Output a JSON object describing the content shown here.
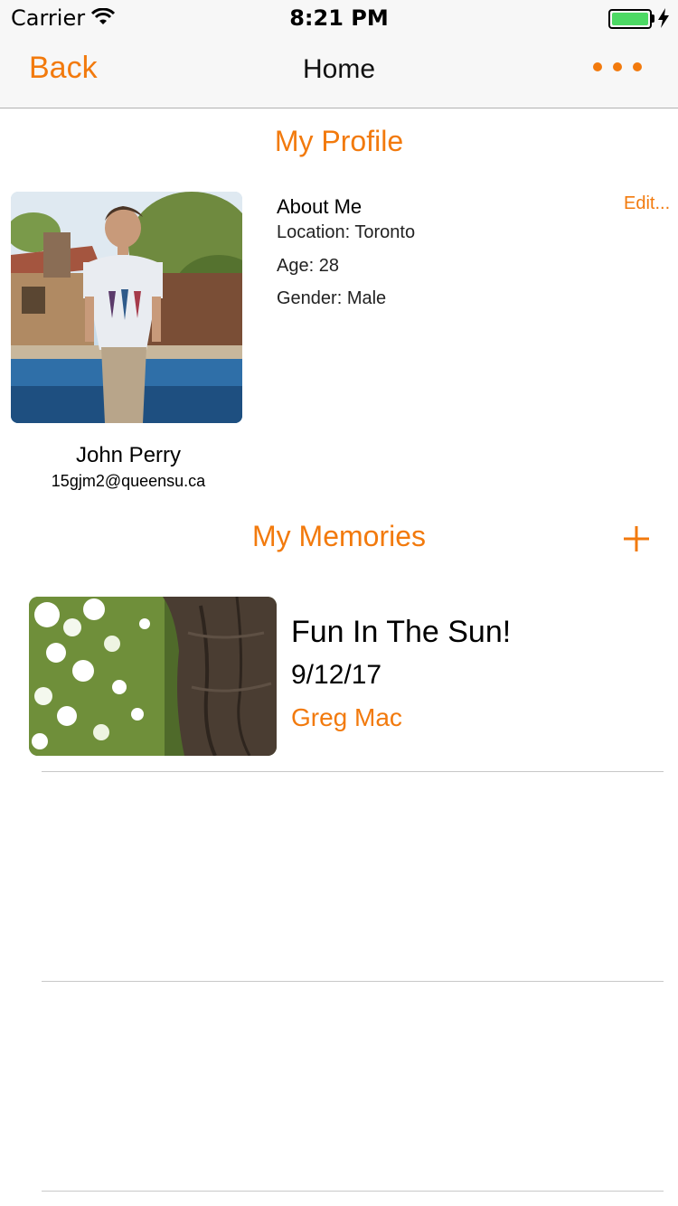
{
  "status_bar": {
    "carrier": "Carrier",
    "time": "8:21 PM",
    "icons": [
      "wifi-icon",
      "battery-icon",
      "charging-bolt-icon"
    ]
  },
  "nav": {
    "back_label": "Back",
    "title": "Home",
    "more_icon": "more-dots-icon"
  },
  "profile": {
    "section_title": "My Profile",
    "name": "John Perry",
    "email": "15gjm2@queensu.ca",
    "about_title": "About Me",
    "edit_label": "Edit...",
    "details": [
      "Location: Toronto",
      "Age: 28",
      "Gender: Male"
    ]
  },
  "memories": {
    "section_title": "My Memories",
    "add_icon": "plus-icon",
    "items": [
      {
        "title": "Fun In The Sun!",
        "date": "9/12/17",
        "author": "Greg Mac"
      }
    ]
  },
  "colors": {
    "accent": "#f27a0d",
    "nav_background": "#f7f7f7",
    "divider": "#c8c8c8",
    "battery": "#4cd964"
  }
}
